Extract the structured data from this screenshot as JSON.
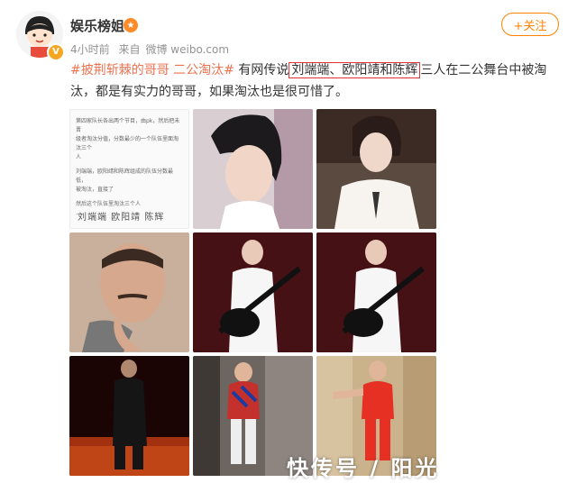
{
  "user": {
    "name": "娱乐榜姐",
    "time": "4小时前",
    "source_prefix": "来自",
    "source": "微博 weibo.com"
  },
  "follow_label": "+关注",
  "post": {
    "topic": "#披荆斩棘的哥哥 二公淘汰#",
    "text_before": " 有网传说",
    "highlighted": "刘端端、欧阳靖和陈辉",
    "text_after": "三人在二公舞台中被淘汰，都是有实力的哥哥，如果淘汰也是很可惜了。"
  },
  "doc_image": {
    "lines": [
      "第四家队长各出两个节目，由pk，然后把未晋",
      "级者淘汰分值，分数最少的一个队伍里面淘汰三个",
      "人",
      "刘端端，欧阳靖和陈辉组成的队伍分数最低，",
      "被淘汰，直接了",
      "然后这个队伍里淘汰三个人",
      "..."
    ],
    "names": "刘端端 欧阳靖 陈辉"
  },
  "watermark": "快传号 / 阳光",
  "icons": {
    "verified": "v-badge-icon",
    "honor": "honor-badge-icon"
  },
  "colors": {
    "accent": "#ff8200",
    "topic": "#eb7350",
    "highlight_box": "#e2323a"
  }
}
